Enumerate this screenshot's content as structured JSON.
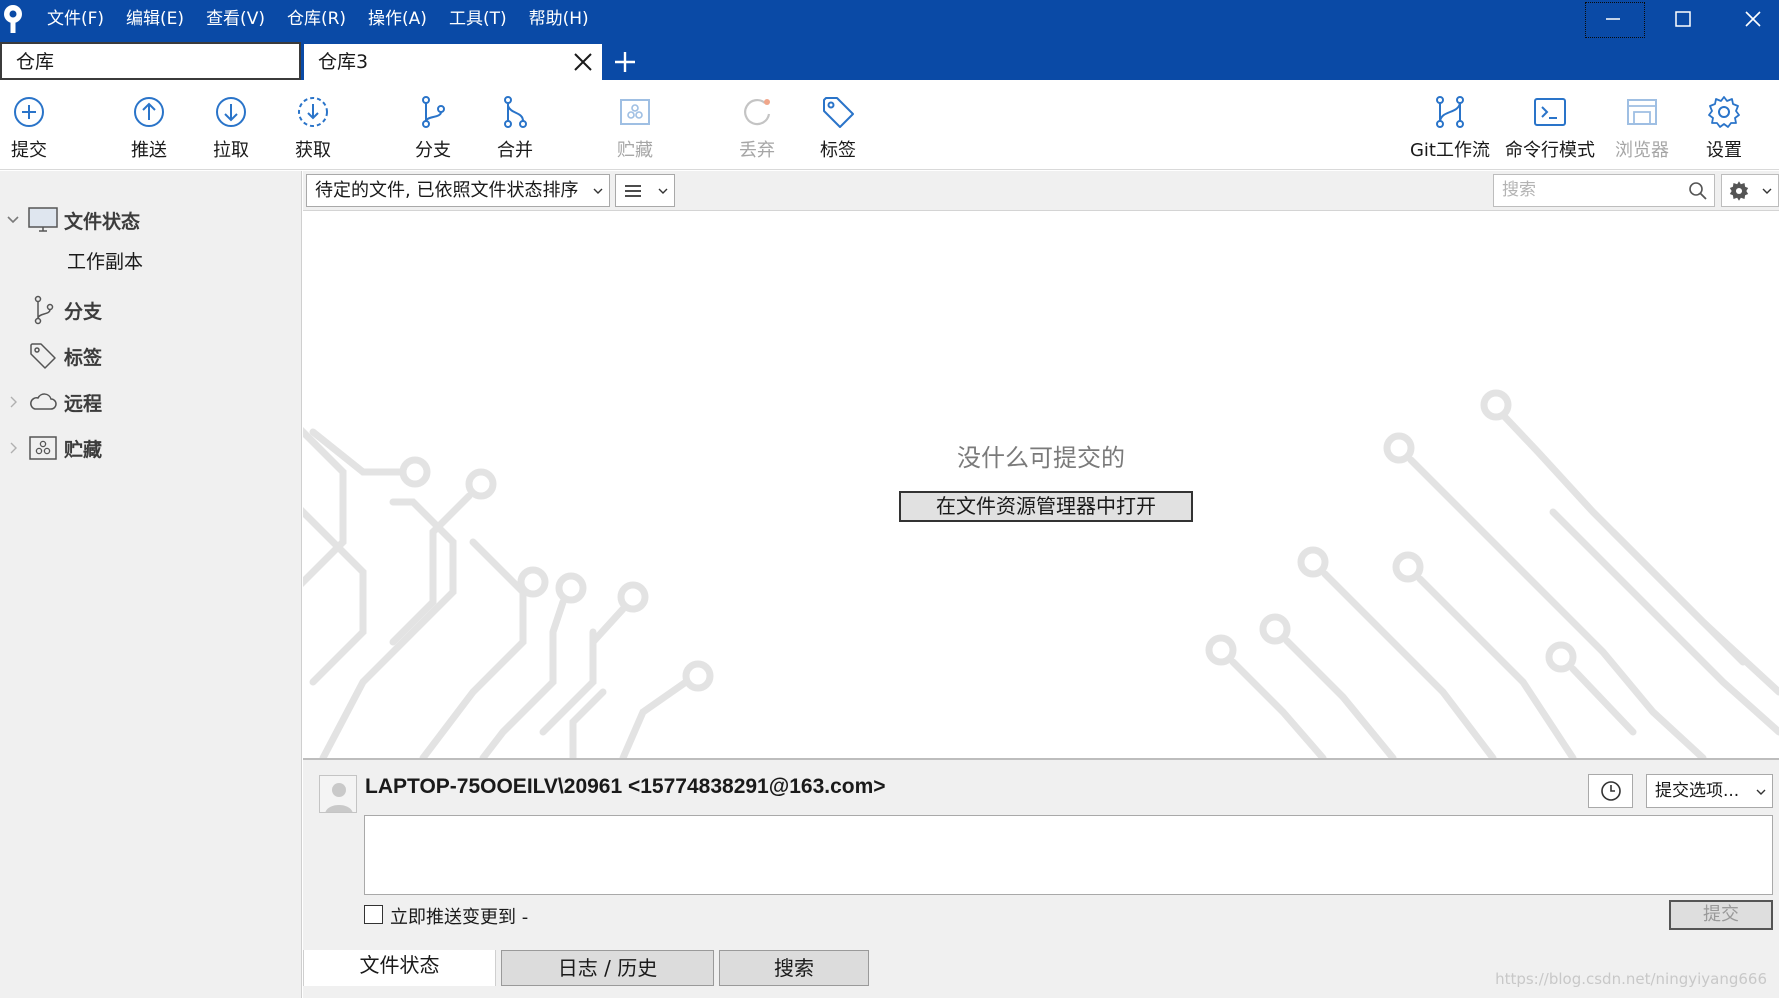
{
  "menubar": {
    "items": [
      "文件(F)",
      "编辑(E)",
      "查看(V)",
      "仓库(R)",
      "操作(A)",
      "工具(T)",
      "帮助(H)"
    ]
  },
  "tabs": [
    {
      "label": "仓库"
    },
    {
      "label": "仓库3"
    }
  ],
  "toolbar": {
    "commit": "提交",
    "push": "推送",
    "pull": "拉取",
    "fetch": "获取",
    "branch": "分支",
    "merge": "合并",
    "stash": "贮藏",
    "discard": "丢弃",
    "tag": "标签",
    "gitflow": "Git工作流",
    "terminal": "命令行模式",
    "browser": "浏览器",
    "settings": "设置"
  },
  "sidebar": {
    "file_status": "文件状态",
    "working_copy": "工作副本",
    "branches": "分支",
    "tags": "标签",
    "remotes": "远程",
    "stashes": "贮藏"
  },
  "filterbar": {
    "sort_value": "待定的文件, 已依照文件状态排序",
    "search_placeholder": "搜索"
  },
  "main": {
    "empty_message": "没什么可提交的",
    "open_explorer": "在文件资源管理器中打开"
  },
  "commit": {
    "author": "LAPTOP-75OOEILV\\20961  <15774838291@163.com>",
    "options_label": "提交选项...",
    "push_immediately": "立即推送变更到 -",
    "commit_button": "提交"
  },
  "bottom_tabs": {
    "file_status": "文件状态",
    "log": "日志 / 历史",
    "search": "搜索"
  },
  "watermark": "https://blog.csdn.net/ningyiyang666",
  "colors": {
    "titlebar": "#0a4aa6",
    "icon_blue": "#2a74c9",
    "disabled": "#a6a6a6"
  }
}
